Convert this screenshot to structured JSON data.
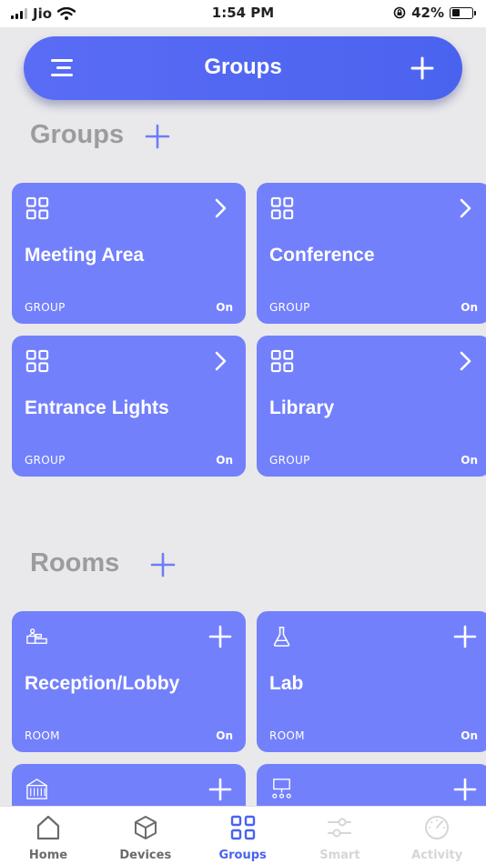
{
  "status": {
    "carrier": "Jio",
    "time": "1:54 PM",
    "battery": "42%",
    "battery_level": 0.42
  },
  "header": {
    "title": "Groups",
    "menu_icon": "menu-icon",
    "add_icon": "plus-icon"
  },
  "groups_section": {
    "title": "Groups",
    "items": [
      {
        "name": "Meeting Area",
        "type": "GROUP",
        "state": "On",
        "icon": "grid-icon"
      },
      {
        "name": "Conference",
        "type": "GROUP",
        "state": "On",
        "icon": "grid-icon"
      },
      {
        "name": "Entrance Lights",
        "type": "GROUP",
        "state": "On",
        "icon": "grid-icon"
      },
      {
        "name": "Library",
        "type": "GROUP",
        "state": "On",
        "icon": "grid-icon"
      }
    ]
  },
  "rooms_section": {
    "title": "Rooms",
    "items": [
      {
        "name": "Reception/Lobby",
        "type": "ROOM",
        "state": "On",
        "icon": "reception-desk-icon"
      },
      {
        "name": "Lab",
        "type": "ROOM",
        "state": "On",
        "icon": "flask-icon"
      },
      {
        "name": "",
        "type": "",
        "state": "",
        "icon": "building-icon"
      },
      {
        "name": "",
        "type": "",
        "state": "",
        "icon": "presentation-icon"
      }
    ]
  },
  "tabs": [
    {
      "label": "Home",
      "icon": "home-icon",
      "color": "#6b6b6b"
    },
    {
      "label": "Devices",
      "icon": "cube-icon",
      "color": "#6b6b6b"
    },
    {
      "label": "Groups",
      "icon": "grid-icon",
      "color": "#4a63ef",
      "active": true
    },
    {
      "label": "Smart",
      "icon": "sliders-icon",
      "color": "#d6d6d6"
    },
    {
      "label": "Activity",
      "icon": "gauge-icon",
      "color": "#d6d6d6"
    }
  ],
  "colors": {
    "accent": "#4a63ef",
    "card": "#7380fc",
    "section_title": "#9c9c9e",
    "background": "#e9e9eb"
  }
}
